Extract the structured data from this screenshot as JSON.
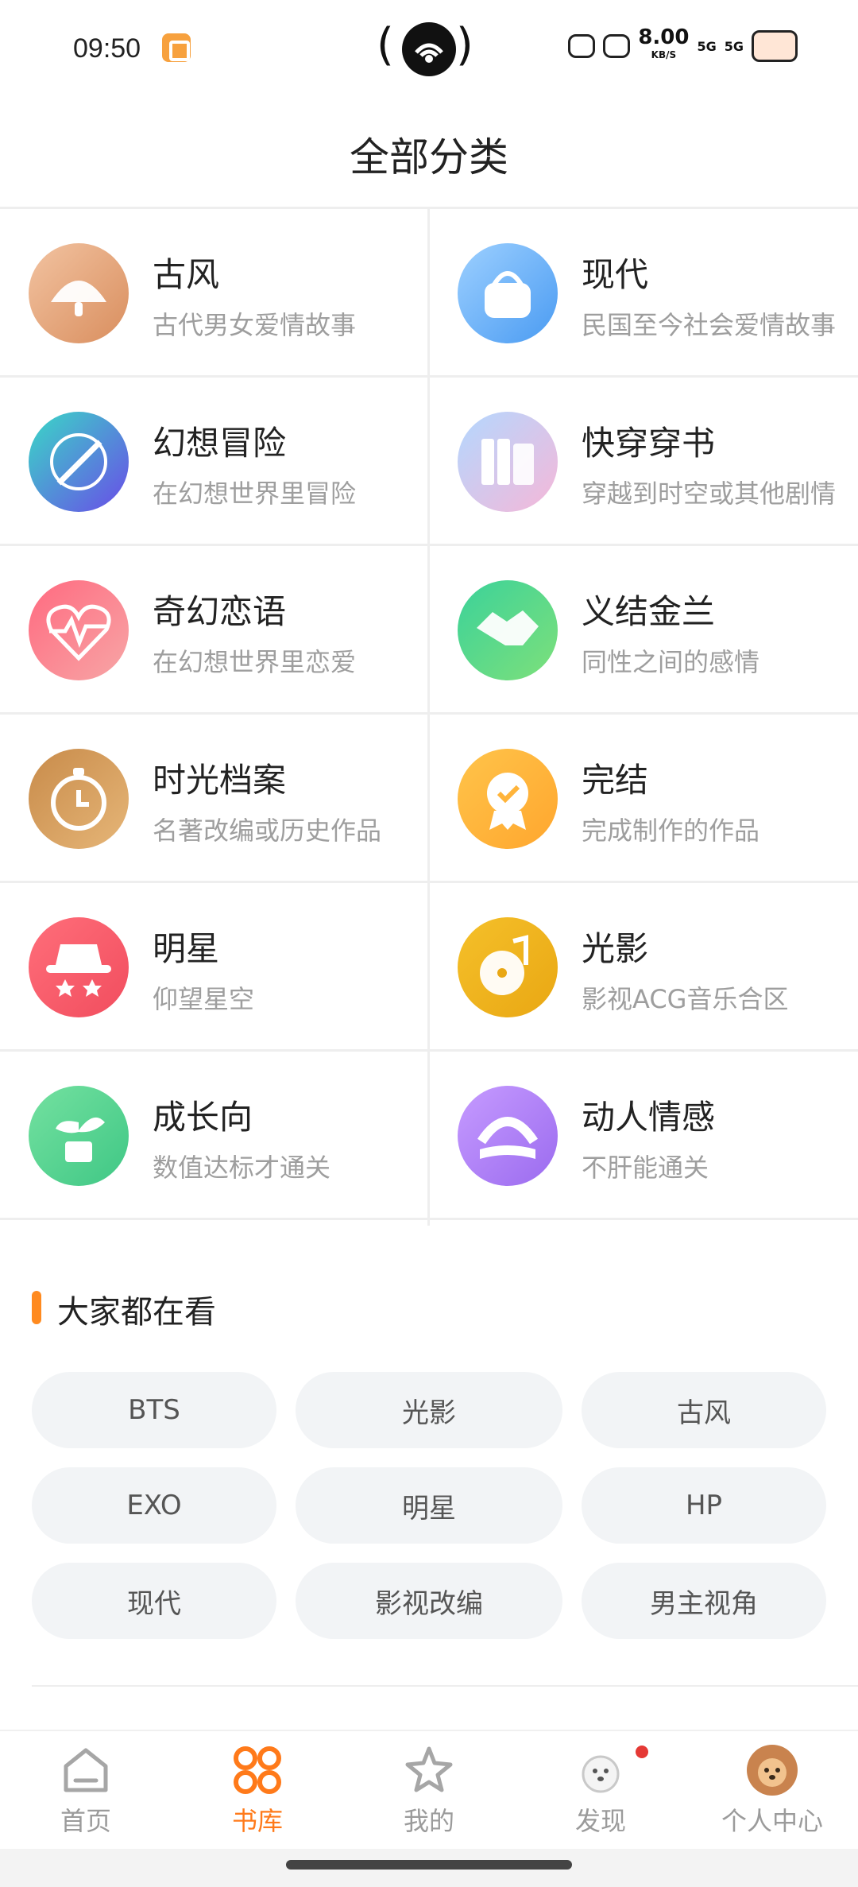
{
  "status": {
    "time": "09:50",
    "speed_value": "8.00",
    "speed_unit": "KB/S",
    "net1": "5G",
    "net2": "5G"
  },
  "header": {
    "title": "全部分类"
  },
  "categories": [
    {
      "name": "古风",
      "desc": "古代男女爱情故事",
      "icon": "fan-icon",
      "color1": "#F2C3A1",
      "color2": "#D98E5E"
    },
    {
      "name": "现代",
      "desc": "民国至今社会爱情故事",
      "icon": "handbag-icon",
      "color1": "#9DD0FF",
      "color2": "#4A9BF2"
    },
    {
      "name": "幻想冒险",
      "desc": "在幻想世界里冒险",
      "icon": "sword-icon",
      "color1": "#39D9C6",
      "color2": "#6A4BE8"
    },
    {
      "name": "快穿穿书",
      "desc": "穿越到时空或其他剧情",
      "icon": "books-icon",
      "color1": "#B3D8FF",
      "color2": "#F6B7D8"
    },
    {
      "name": "奇幻恋语",
      "desc": "在幻想世界里恋爱",
      "icon": "heartbeat-icon",
      "color1": "#FF6A80",
      "color2": "#F7A6A6"
    },
    {
      "name": "义结金兰",
      "desc": "同性之间的感情",
      "icon": "handshake-icon",
      "color1": "#3BD29A",
      "color2": "#7EE07A"
    },
    {
      "name": "时光档案",
      "desc": "名著改编或历史作品",
      "icon": "stopwatch-icon",
      "color1": "#C88B4A",
      "color2": "#E6B678"
    },
    {
      "name": "完结",
      "desc": "完成制作的作品",
      "icon": "badge-icon",
      "color1": "#FFC44A",
      "color2": "#FFA62E"
    },
    {
      "name": "明星",
      "desc": "仰望星空",
      "icon": "hat-stars-icon",
      "color1": "#FF6E7A",
      "color2": "#F14D5E"
    },
    {
      "name": "光影",
      "desc": "影视ACG音乐合区",
      "icon": "film-music-icon",
      "color1": "#F5C02A",
      "color2": "#E9A713"
    },
    {
      "name": "成长向",
      "desc": "数值达标才通关",
      "icon": "sprout-icon",
      "color1": "#74E1A0",
      "color2": "#3FC785"
    },
    {
      "name": "动人情感",
      "desc": "不肝能通关",
      "icon": "rainbow-book-icon",
      "color1": "#C69BFF",
      "color2": "#9B6BEF"
    }
  ],
  "section": {
    "title": "大家都在看",
    "tags": [
      "BTS",
      "光影",
      "古风",
      "EXO",
      "明星",
      "HP",
      "现代",
      "影视改编",
      "男主视角"
    ]
  },
  "tabs": [
    {
      "label": "首页",
      "icon": "home-icon"
    },
    {
      "label": "书库",
      "icon": "grid-icon"
    },
    {
      "label": "我的",
      "icon": "star-icon"
    },
    {
      "label": "发现",
      "icon": "dog-icon"
    },
    {
      "label": "个人中心",
      "icon": "avatar-icon"
    }
  ],
  "accent": "#FF7A1A"
}
